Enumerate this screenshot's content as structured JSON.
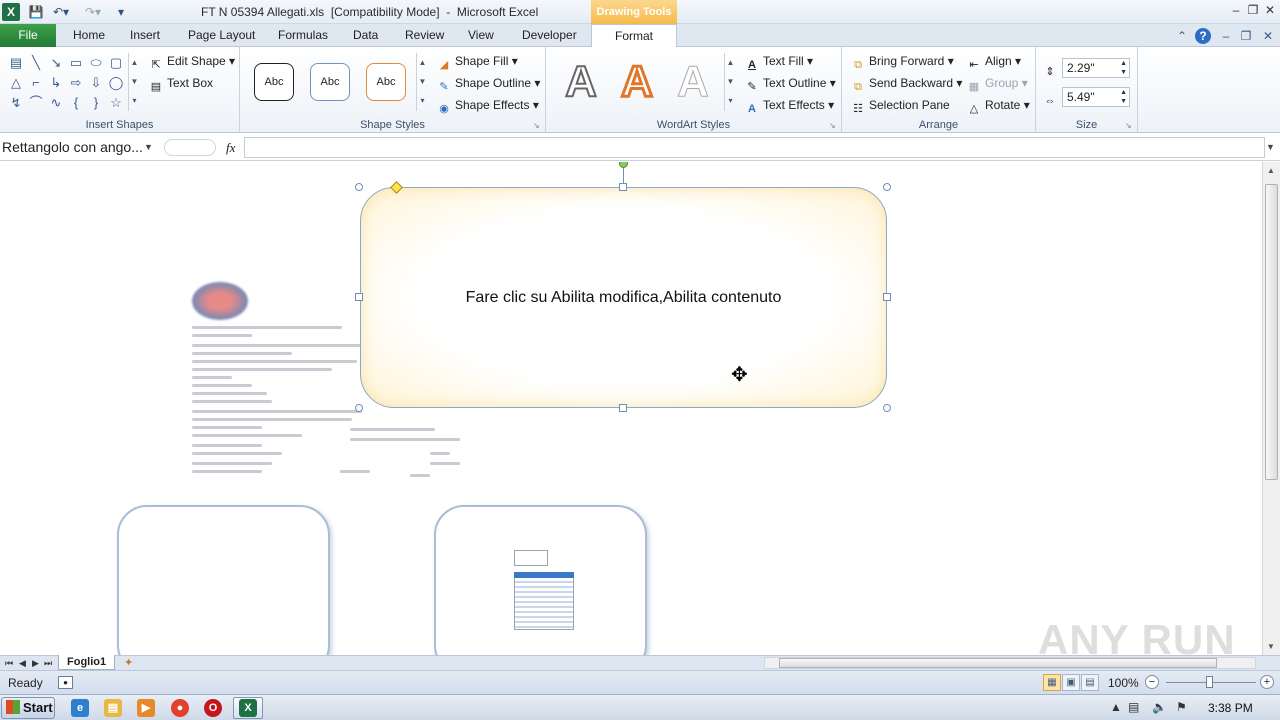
{
  "window": {
    "title": "FT N 05394 Allegati.xls  [Compatibility Mode]  -  Microsoft Excel",
    "contextual_tab_group": "Drawing Tools"
  },
  "ribbon_tabs": [
    {
      "label": "File"
    },
    {
      "label": "Home"
    },
    {
      "label": "Insert"
    },
    {
      "label": "Page Layout"
    },
    {
      "label": "Formulas"
    },
    {
      "label": "Data"
    },
    {
      "label": "Review"
    },
    {
      "label": "View"
    },
    {
      "label": "Developer"
    },
    {
      "label": "Format"
    }
  ],
  "ribbon": {
    "insert_shapes": {
      "edit_shape": "Edit Shape",
      "text_box": "Text Box",
      "label": "Insert Shapes"
    },
    "shape_styles": {
      "thumbs": [
        "Abc",
        "Abc",
        "Abc"
      ],
      "shape_fill": "Shape Fill",
      "shape_outline": "Shape Outline",
      "shape_effects": "Shape Effects",
      "label": "Shape Styles"
    },
    "wordart_styles": {
      "letters": [
        "A",
        "A",
        "A"
      ],
      "text_fill": "Text Fill",
      "text_outline": "Text Outline",
      "text_effects": "Text Effects",
      "label": "WordArt Styles"
    },
    "arrange": {
      "bring_forward": "Bring Forward",
      "send_backward": "Send Backward",
      "selection_pane": "Selection Pane",
      "align": "Align",
      "group": "Group",
      "rotate": "Rotate",
      "label": "Arrange"
    },
    "size": {
      "height": "2.29\"",
      "width": "5.49\"",
      "label": "Size"
    }
  },
  "formula_bar": {
    "name_box": "Rettangolo con ango...",
    "fx": "fx",
    "formula": ""
  },
  "sheet": {
    "shape_text": "Fare clic su Abilita modifica,Abilita contenuto",
    "watermark": "ANY RUN"
  },
  "sheet_tabs": {
    "active": "Foglio1"
  },
  "status": {
    "ready": "Ready",
    "zoom": "100%"
  },
  "taskbar": {
    "start": "Start",
    "time": "3:38 PM"
  },
  "colors": {
    "file_tab": "#217a35",
    "drawing_tools": "#f7b94a",
    "shape_border": "#8da7c6",
    "shape_glow": "#fff4d6"
  }
}
